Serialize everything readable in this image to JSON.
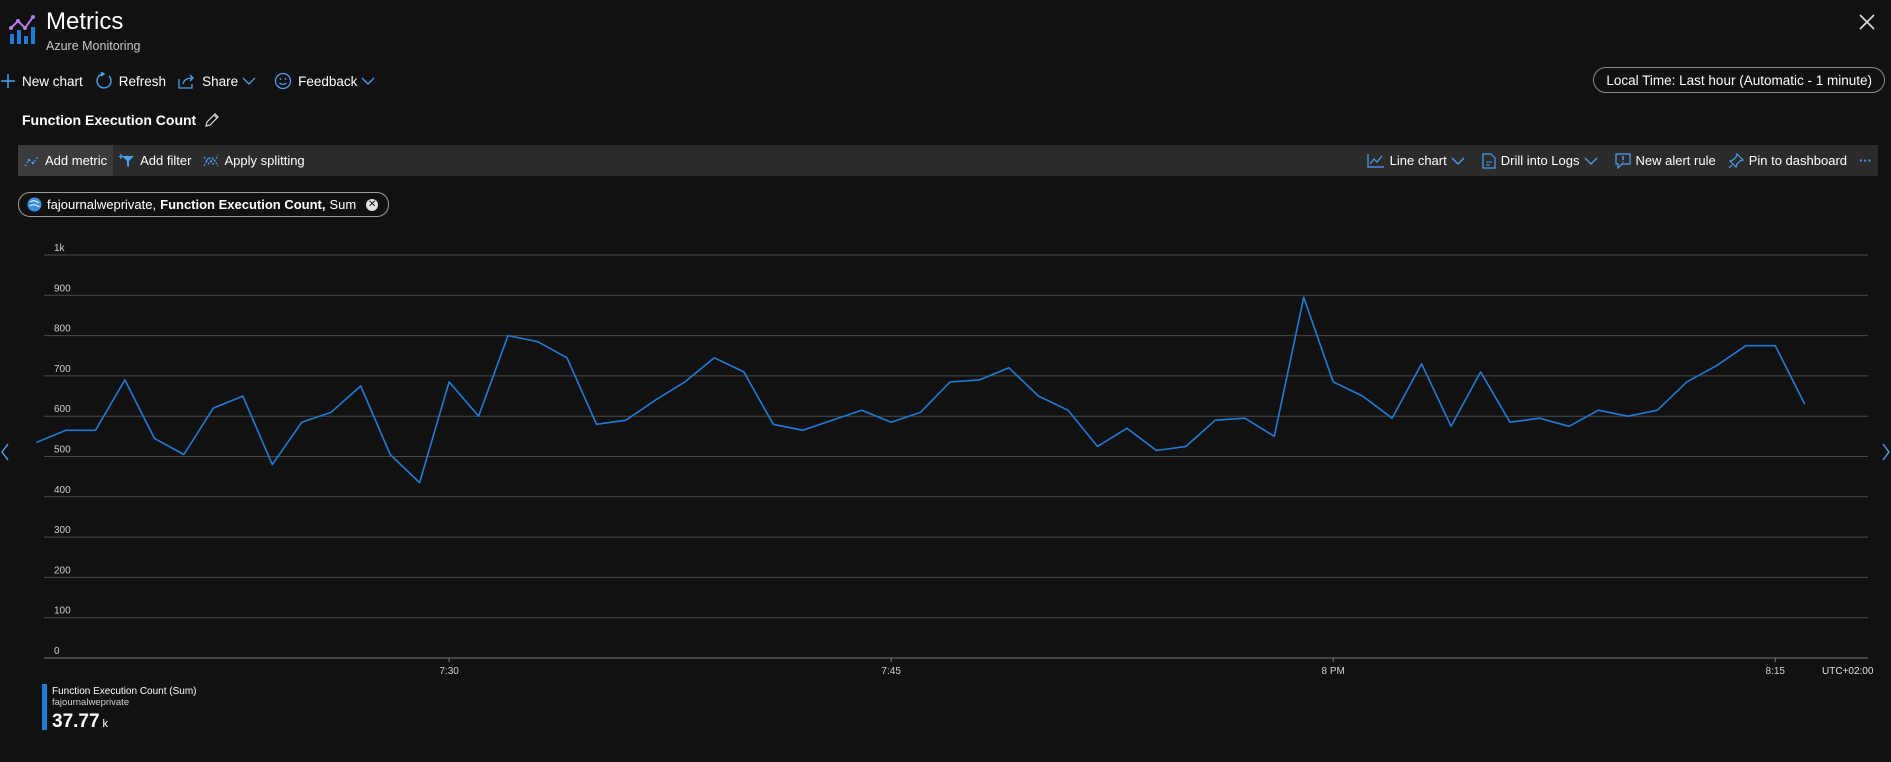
{
  "header": {
    "title": "Metrics",
    "subtitle": "Azure Monitoring"
  },
  "commandbar": {
    "new_chart": "New chart",
    "refresh": "Refresh",
    "share": "Share",
    "feedback": "Feedback"
  },
  "time_range": "Local Time: Last hour (Automatic - 1 minute)",
  "chart_title": "Function Execution Count",
  "toolbar": {
    "add_metric": "Add metric",
    "add_filter": "Add filter",
    "apply_splitting": "Apply splitting",
    "line_chart": "Line chart",
    "drill_into_logs": "Drill into Logs",
    "new_alert_rule": "New alert rule",
    "pin_to_dashboard": "Pin to dashboard",
    "more": "···"
  },
  "metric_pill": {
    "resource": "fajournalweprivate,",
    "metric": "Function Execution Count,",
    "aggregation": "Sum"
  },
  "legend": {
    "metric": "Function Execution Count (Sum)",
    "resource": "fajournalweprivate",
    "value": "37.77",
    "unit": "k"
  },
  "colors": {
    "series": "#1f7cd6",
    "background": "#111111",
    "toolbar": "#2b2b2b"
  },
  "chart_data": {
    "type": "line",
    "y_ticks": [
      "0",
      "100",
      "200",
      "300",
      "400",
      "500",
      "600",
      "700",
      "800",
      "900",
      "1k"
    ],
    "ylim": [
      0,
      1000
    ],
    "x_ticks": [
      {
        "label": "7:30",
        "minute": 13
      },
      {
        "label": "7:45",
        "minute": 28
      },
      {
        "label": "8 PM",
        "minute": 43
      },
      {
        "label": "8:15",
        "minute": 58
      }
    ],
    "timezone": "UTC+02:00",
    "grid": true,
    "series": [
      {
        "name": "Function Execution Count (Sum)",
        "minute_start": -1,
        "values": [
          535,
          565,
          565,
          690,
          545,
          505,
          620,
          650,
          480,
          585,
          610,
          675,
          505,
          435,
          685,
          600,
          800,
          785,
          745,
          580,
          590,
          640,
          685,
          745,
          710,
          580,
          565,
          590,
          615,
          585,
          610,
          685,
          690,
          720,
          650,
          615,
          525,
          570,
          515,
          525,
          590,
          595,
          550,
          895,
          685,
          650,
          595,
          730,
          575,
          710,
          585,
          595,
          575,
          615,
          600,
          615,
          685,
          725,
          775,
          775,
          630
        ]
      }
    ]
  }
}
